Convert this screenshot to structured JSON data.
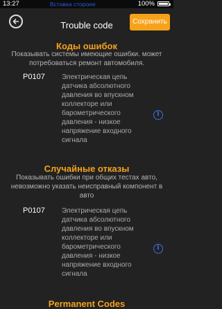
{
  "status_bar": {
    "time": "13:27",
    "center_text": "Вставка стороне",
    "battery": "100%"
  },
  "nav": {
    "title": "Trouble code",
    "save_label": "Сохранить",
    "back_icon": "back-arrow-icon"
  },
  "sections": [
    {
      "title": "Коды ошибок",
      "description": "Показывать системы имеющие ошибки. может потребоваться ремонт автомобиля.",
      "code": "P0107",
      "code_description": "Электрическая цепь датчика абсолютного давления во впускном коллекторе или барометрического давления - низкое напряжение входного сигнала"
    },
    {
      "title": "Случайные отказы",
      "description": "Показывать ошибки при общих тестах авто, невозможно указать неисправный компонент в авто",
      "code": "P0107",
      "code_description": "Электрическая цепь датчика абсолютного давления во впускном коллекторе или барометрического давления - низкое напряжение входного сигнала"
    },
    {
      "title": "Permanent Codes"
    }
  ],
  "colors": {
    "accent": "#f5a21d",
    "save_button": "#f7a21b",
    "info_icon": "#3b6ee2",
    "background": "#222222"
  }
}
